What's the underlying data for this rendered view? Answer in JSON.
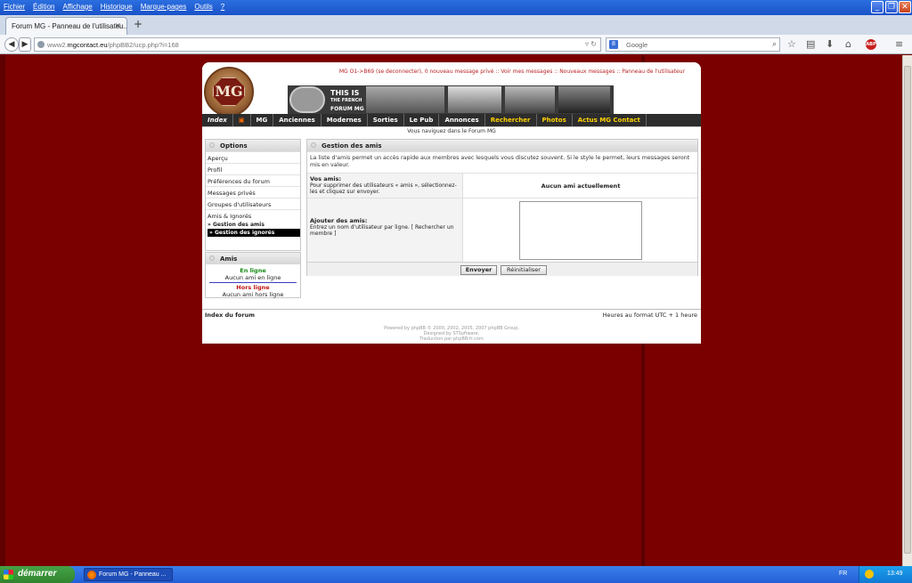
{
  "browser": {
    "menu": [
      "Fichier",
      "Édition",
      "Affichage",
      "Historique",
      "Marque-pages",
      "Outils",
      "?"
    ],
    "tab_title": "Forum MG - Panneau de l'utilisateu...",
    "url_prefix": "www2.",
    "url_host": "mgcontact.eu",
    "url_path": "/phpBB2/ucp.php?i=168",
    "search_placeholder": "Google"
  },
  "forum": {
    "top_links": "MG O1->B69 (se deconnecter), 0 nouveau message privé :: Voir mes messages :: Nouveaux messages :: Panneau de l'utilisateur",
    "logo_text": "MG",
    "banner_line1": "THIS IS",
    "banner_line2": "THE FRENCH",
    "banner_line3": "FORUM MG",
    "menu": [
      "Index",
      "MG",
      "Anciennes",
      "Modernes",
      "Sorties",
      "Le Pub",
      "Annonces",
      "Rechercher",
      "Photos",
      "Actus MG Contact"
    ],
    "nav_text": "Vous naviguez dans le Forum MG"
  },
  "sidebar": {
    "options_title": "Options",
    "items": [
      "Aperçu",
      "Profil",
      "Préférences du forum",
      "Messages privés",
      "Groupes d'utilisateurs"
    ],
    "friends_group": "Amis & Ignorés",
    "friends_sub": "» Gestion des amis",
    "ignored_sub": "» Gestion des ignorés",
    "amis_title": "Amis",
    "online": "En ligne",
    "no_online": "Aucun ami en ligne",
    "offline": "Hors ligne",
    "no_offline": "Aucun ami hors ligne"
  },
  "main": {
    "title": "Gestion des amis",
    "intro": "La liste d'amis permet un accès rapide aux membres avec lesquels vous discutez souvent. Si le style le permet, leurs messages seront mis en valeur.",
    "your_friends_label": "Vos amis:",
    "your_friends_help": "Pour supprimer des utilisateurs « amis », sélectionnez-les et cliquez sur envoyer.",
    "no_friends": "Aucun ami actuellement",
    "add_label": "Ajouter des amis:",
    "add_help": "Entrez un nom d'utilisateur par ligne. [ Rechercher un membre ]",
    "submit": "Envoyer",
    "reset": "Réinitialiser"
  },
  "footer": {
    "index_link": "Index du forum",
    "timezone": "Heures au format UTC + 1 heure",
    "credit1": "Powered by phpBB © 2000, 2002, 2005, 2007 phpBB Group.",
    "credit2": "Designed by STSoftware.",
    "credit3": "Traduction par phpBB-fr.com"
  },
  "taskbar": {
    "start": "démarrer",
    "task": "Forum MG - Panneau ...",
    "lang": "FR",
    "clock": "13:49"
  }
}
